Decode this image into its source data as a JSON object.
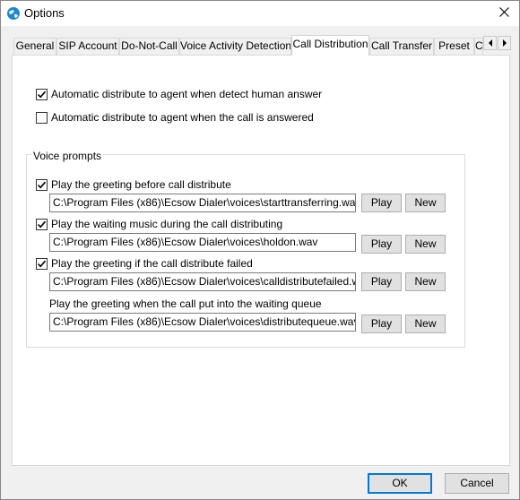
{
  "window": {
    "title": "Options",
    "close_symbol": "✕"
  },
  "tabs": [
    {
      "label": "General"
    },
    {
      "label": "SIP Account"
    },
    {
      "label": "Do-Not-Call"
    },
    {
      "label": "Voice Activity Detection"
    },
    {
      "label": "Call Distribution"
    },
    {
      "label": "Call Transfer"
    },
    {
      "label": "Preset"
    },
    {
      "label": "C"
    }
  ],
  "active_tab": "Call Distribution",
  "distribution": {
    "auto_on_human": {
      "label": "Automatic distribute to agent when detect human answer",
      "checked": true
    },
    "auto_on_answered": {
      "label": "Automatic distribute to agent when the call is answered",
      "checked": false
    }
  },
  "voice_prompts": {
    "group_label": "Voice prompts",
    "items": [
      {
        "label": "Play the greeting before call distribute",
        "has_checkbox": true,
        "checked": true,
        "path": "C:\\Program Files (x86)\\Ecsow Dialer\\voices\\starttransferring.wav"
      },
      {
        "label": "Play the waiting music during the call distributing",
        "has_checkbox": true,
        "checked": true,
        "path": "C:\\Program Files (x86)\\Ecsow Dialer\\voices\\holdon.wav"
      },
      {
        "label": "Play the greeting if the call distribute failed",
        "has_checkbox": true,
        "checked": true,
        "path": "C:\\Program Files (x86)\\Ecsow Dialer\\voices\\calldistributefailed.wav"
      },
      {
        "label": "Play the greeting when the call put into the waiting queue",
        "has_checkbox": false,
        "path": "C:\\Program Files (x86)\\Ecsow Dialer\\voices\\distributequeue.wav"
      }
    ],
    "play_label": "Play",
    "new_label": "New"
  },
  "footer": {
    "ok_label": "OK",
    "cancel_label": "Cancel"
  },
  "colors": {
    "accent": "#0078d7",
    "panel": "#ffffff",
    "chrome": "#f0f0f0"
  }
}
